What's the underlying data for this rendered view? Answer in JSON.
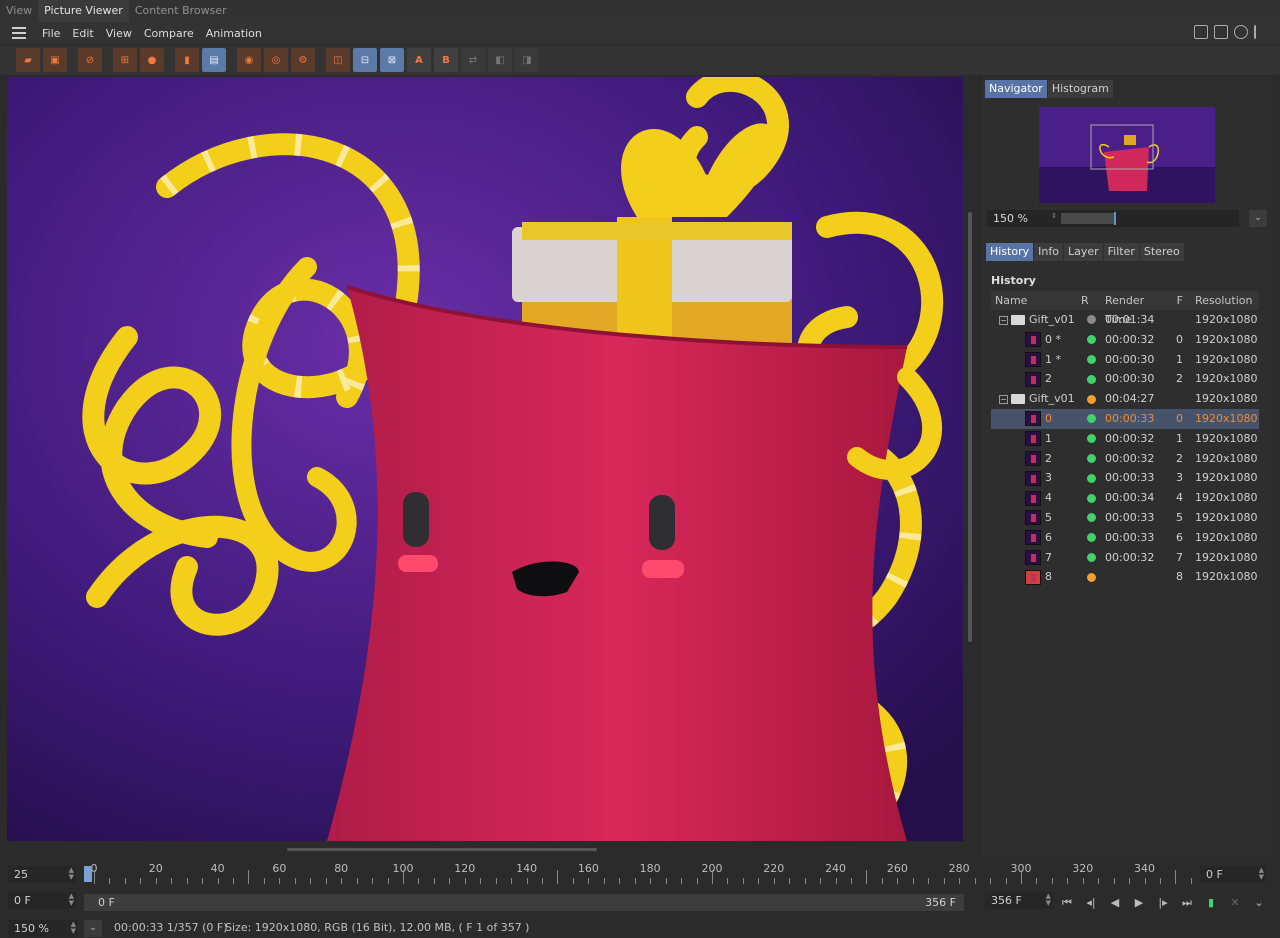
{
  "tabs": [
    "View",
    "Picture Viewer",
    "Content Browser"
  ],
  "active_tab": 1,
  "menu": [
    "File",
    "Edit",
    "View",
    "Compare",
    "Animation"
  ],
  "toolbar": {
    "open_icon": "open-folder-icon",
    "save_icon": "save-icon",
    "ab_a": "A",
    "ab_b": "B"
  },
  "navigator": {
    "tabs": [
      "Navigator",
      "Histogram"
    ],
    "zoom": "150 %",
    "zoom_fraction": 0.3
  },
  "history_panel": {
    "tabs": [
      "History",
      "Info",
      "Layer",
      "Filter",
      "Stereo"
    ],
    "title": "History",
    "columns": [
      "Name",
      "R",
      "Render Time",
      "F",
      "Resolution"
    ],
    "rows": [
      {
        "type": "group",
        "name": "Gift_v01",
        "status": "#8a8a8a",
        "time": "00:01:34",
        "frame": "",
        "res": "1920x1080"
      },
      {
        "type": "item",
        "name": "0 *",
        "status": "#3fd36a",
        "time": "00:00:32",
        "frame": "0",
        "res": "1920x1080"
      },
      {
        "type": "item",
        "name": "1 *",
        "status": "#3fd36a",
        "time": "00:00:30",
        "frame": "1",
        "res": "1920x1080"
      },
      {
        "type": "item",
        "name": "2",
        "status": "#3fd36a",
        "time": "00:00:30",
        "frame": "2",
        "res": "1920x1080"
      },
      {
        "type": "group",
        "name": "Gift_v01",
        "status": "#f0a02e",
        "time": "00:04:27",
        "frame": "",
        "res": "1920x1080"
      },
      {
        "type": "item",
        "name": "0",
        "status": "#3fd36a",
        "time": "00:00:33",
        "frame": "0",
        "res": "1920x1080",
        "selected": true
      },
      {
        "type": "item",
        "name": "1",
        "status": "#3fd36a",
        "time": "00:00:32",
        "frame": "1",
        "res": "1920x1080"
      },
      {
        "type": "item",
        "name": "2",
        "status": "#3fd36a",
        "time": "00:00:32",
        "frame": "2",
        "res": "1920x1080"
      },
      {
        "type": "item",
        "name": "3",
        "status": "#3fd36a",
        "time": "00:00:33",
        "frame": "3",
        "res": "1920x1080"
      },
      {
        "type": "item",
        "name": "4",
        "status": "#3fd36a",
        "time": "00:00:34",
        "frame": "4",
        "res": "1920x1080"
      },
      {
        "type": "item",
        "name": "5",
        "status": "#3fd36a",
        "time": "00:00:33",
        "frame": "5",
        "res": "1920x1080"
      },
      {
        "type": "item",
        "name": "6",
        "status": "#3fd36a",
        "time": "00:00:33",
        "frame": "6",
        "res": "1920x1080"
      },
      {
        "type": "item",
        "name": "7",
        "status": "#3fd36a",
        "time": "00:00:32",
        "frame": "7",
        "res": "1920x1080"
      },
      {
        "type": "item",
        "name": "8",
        "status": "#f0a02e",
        "time": "",
        "frame": "8",
        "res": "1920x1080",
        "rendering": true
      }
    ]
  },
  "timeline": {
    "fps": "25",
    "start": "0 F",
    "ticks": [
      "0",
      "20",
      "40",
      "60",
      "80",
      "100",
      "120",
      "140",
      "160",
      "180",
      "200",
      "220",
      "240",
      "260",
      "280",
      "300",
      "320",
      "340"
    ],
    "current": "0 F",
    "range_start": "0 F",
    "range_end": "356 F",
    "end_field": "356 F"
  },
  "status": {
    "zoom": "150 %",
    "info": "00:00:33 1/357 (0 F)",
    "size": "Size: 1920x1080, RGB (16 Bit), 12.00 MB,  ( F 1 of 357 )"
  },
  "colors": {
    "accent": "#5874a6",
    "selected_text": "#f08a2e",
    "background": "#2b2b2b"
  }
}
